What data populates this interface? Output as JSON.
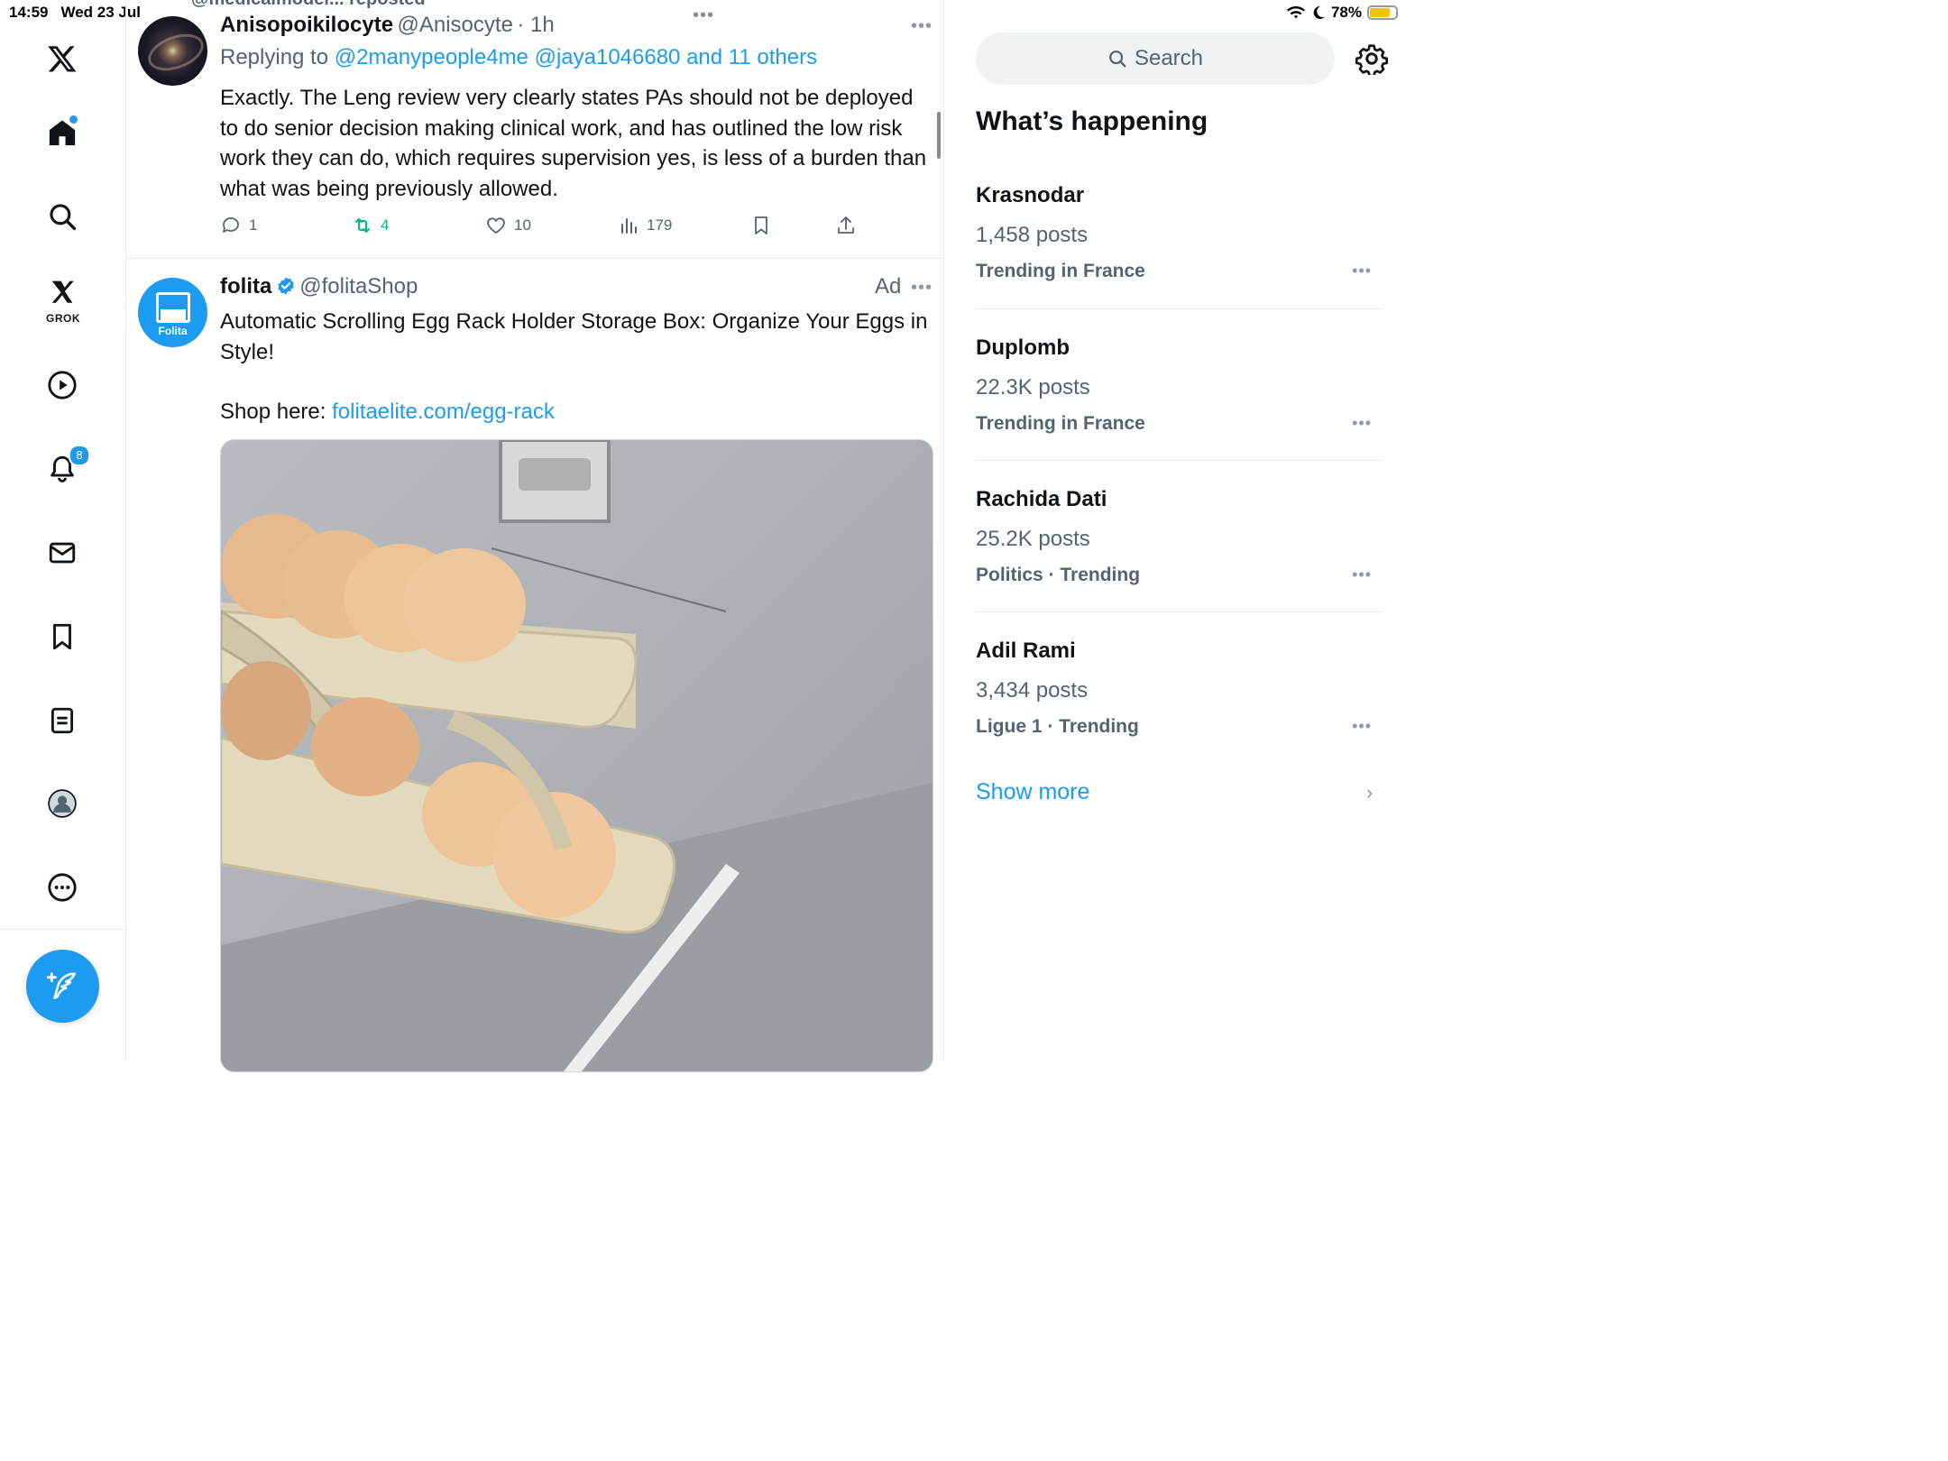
{
  "status_bar": {
    "time": "14:59",
    "date": "Wed 23 Jul",
    "battery": "78%",
    "battery_level": 0.78
  },
  "sidebar": {
    "notifications_badge": "8",
    "grok_label": "GROK"
  },
  "tweet1": {
    "repost_text": "@medicalmodel... reposted",
    "name": "Anisopoikilocyte",
    "handle": "@Anisocyte",
    "time": "· 1h",
    "replying_prefix": "Replying to ",
    "replying_to": "@2manypeople4me @jaya1046680 and 11 others",
    "text": "Exactly. The Leng review very clearly states PAs should not be deployed to do senior decision making clinical work, and has outlined the low risk work they can do, which requires supervision yes, is less of a burden than what was being previously allowed.",
    "replies": "1",
    "reposts": "4",
    "likes": "10",
    "views": "179"
  },
  "tweet2": {
    "name": "folita",
    "handle": "@folitaShop",
    "ad_label": "Ad",
    "avatar_label": "Folita",
    "text": "Automatic Scrolling Egg Rack Holder Storage Box: Organize Your Eggs in Style!",
    "shop_prefix": "Shop here: ",
    "shop_link": "folitaelite.com/egg-rack"
  },
  "right": {
    "search_placeholder": "Search",
    "title": "What’s happening",
    "trends": [
      {
        "name": "Krasnodar",
        "count": "1,458 posts",
        "context": "Trending in France"
      },
      {
        "name": "Duplomb",
        "count": "22.3K posts",
        "context": "Trending in France"
      },
      {
        "name": "Rachida Dati",
        "count": "25.2K posts",
        "context": "Politics · Trending"
      },
      {
        "name": "Adil Rami",
        "count": "3,434 posts",
        "context": "Ligue 1 · Trending"
      }
    ],
    "show_more": "Show more"
  },
  "colors": {
    "accent": "#1d9bf0",
    "repost_green": "#00ba7c",
    "muted": "#536471"
  }
}
